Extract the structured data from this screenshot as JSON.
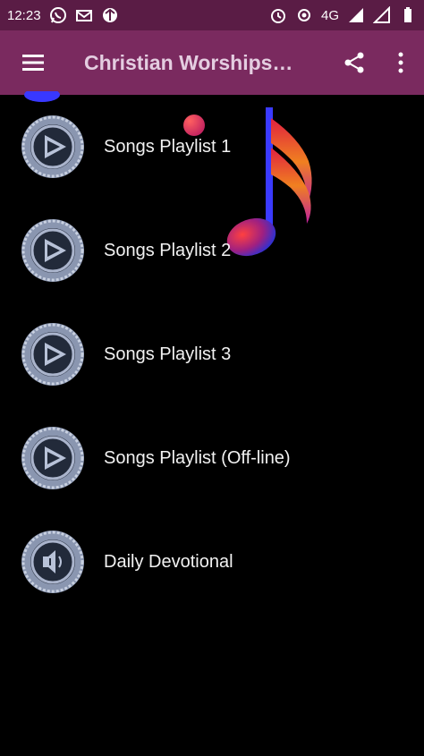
{
  "status_bar": {
    "time": "12:23",
    "network": "4G",
    "left_icons": [
      "whatsapp-icon",
      "mail-icon",
      "app-icon"
    ],
    "right_icons": [
      "alarm-icon",
      "hotspot-icon",
      "signal-icon",
      "signal-icon",
      "battery-icon"
    ]
  },
  "app_bar": {
    "title": "Christian Worships…",
    "menu_icon": "hamburger-menu-icon",
    "share_icon": "share-icon",
    "more_icon": "more-vertical-icon",
    "color": "#7a2a5f",
    "status_color": "#5a1c45"
  },
  "menu": {
    "items": [
      {
        "label": "Songs Playlist 1",
        "icon": "play-icon"
      },
      {
        "label": "Songs Playlist 2",
        "icon": "play-icon"
      },
      {
        "label": "Songs Playlist 3",
        "icon": "play-icon"
      },
      {
        "label": "Songs Playlist (Off-line)",
        "icon": "play-icon"
      },
      {
        "label": "Daily Devotional",
        "icon": "speaker-icon"
      }
    ]
  }
}
